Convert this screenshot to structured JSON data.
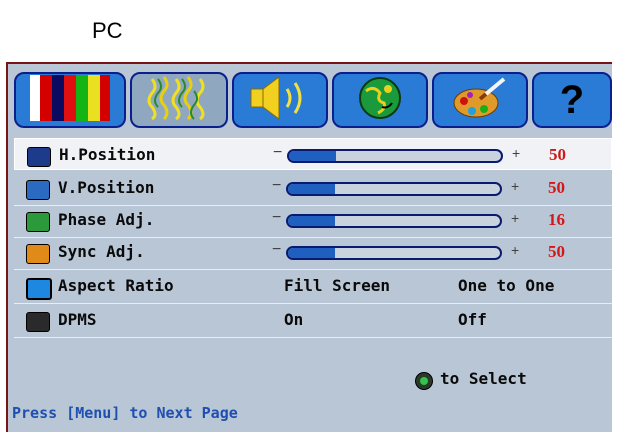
{
  "caption": "PC",
  "tabs": [
    {
      "name": "color-bars-icon"
    },
    {
      "name": "wave-pattern-icon"
    },
    {
      "name": "speaker-icon"
    },
    {
      "name": "globe-icon"
    },
    {
      "name": "paint-palette-icon"
    },
    {
      "name": "help-icon",
      "label": "?"
    }
  ],
  "rows": [
    {
      "label": "H.Position",
      "value": "50",
      "level_percent": 22
    },
    {
      "label": "V.Position",
      "value": "50",
      "level_percent": 22
    },
    {
      "label": "Phase Adj.",
      "value": "16",
      "level_percent": 22
    },
    {
      "label": "Sync Adj.",
      "value": "50",
      "level_percent": 22
    }
  ],
  "aspect": {
    "label": "Aspect Ratio",
    "option1": "Fill Screen",
    "option2": "One to One"
  },
  "dpms": {
    "label": "DPMS",
    "option1": "On",
    "option2": "Off"
  },
  "hint": "to Select",
  "footer": "Press [Menu] to Next Page",
  "colors": {
    "accent_value": "#d01818",
    "tab_blue": "#2a7bd6",
    "border": "#7a1414"
  }
}
